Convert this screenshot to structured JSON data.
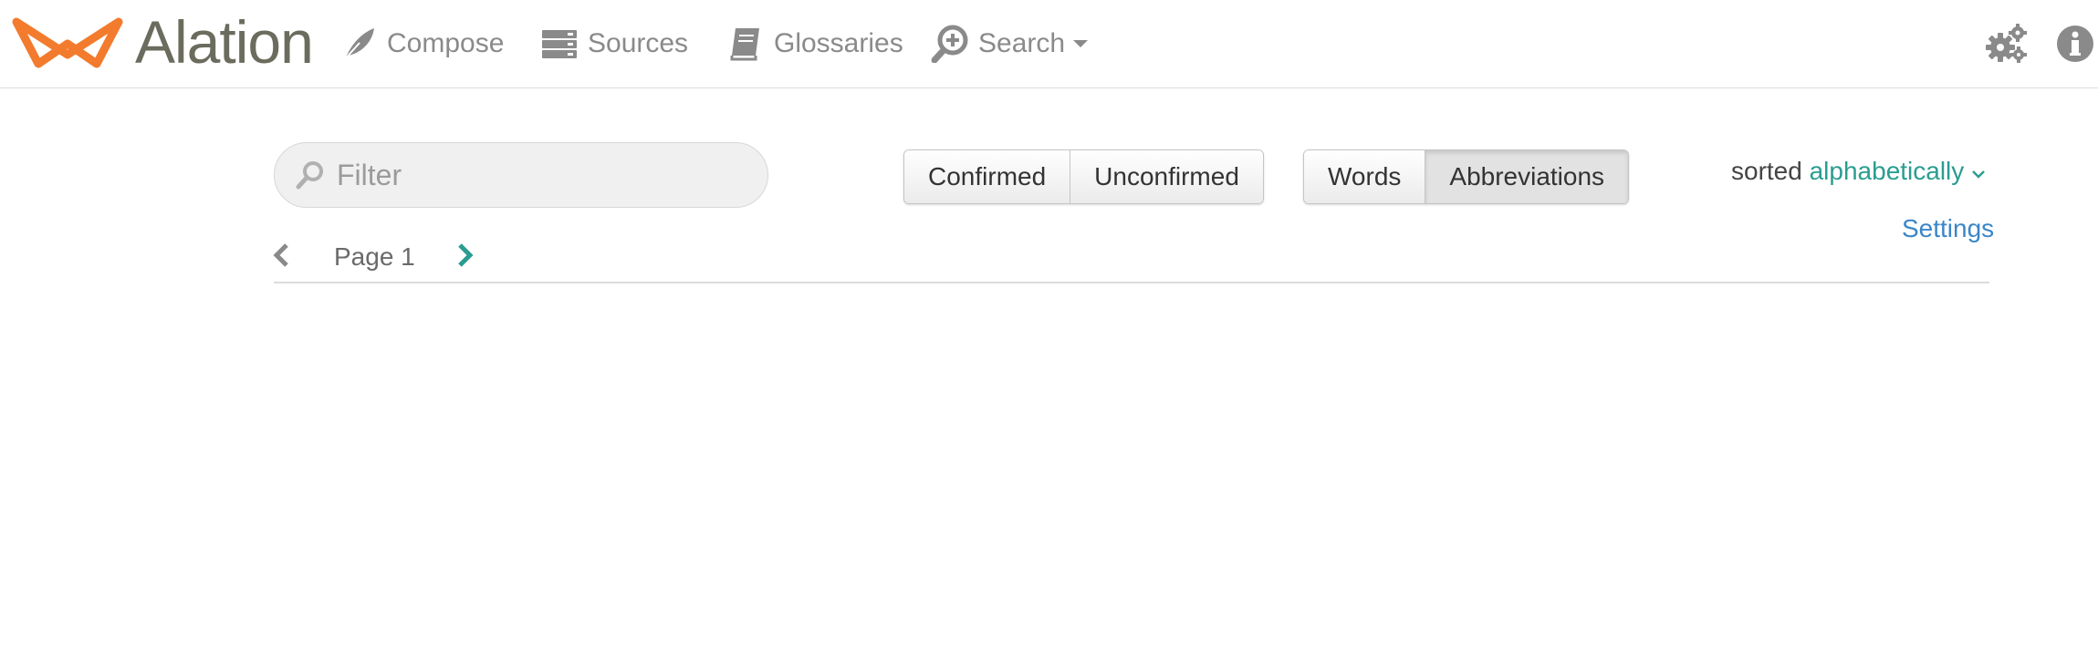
{
  "brand": {
    "name": "Alation",
    "mark_color": "#f37b2d",
    "text_color": "#6b6b5e"
  },
  "nav": {
    "items": [
      {
        "label": "Compose",
        "icon": "feather-icon"
      },
      {
        "label": "Sources",
        "icon": "server-stack-icon"
      },
      {
        "label": "Glossaries",
        "icon": "book-icon"
      },
      {
        "label": "Search",
        "icon": "search-plus-icon",
        "has_dropdown": true
      }
    ],
    "right_icons": [
      "gears-icon",
      "info-circle-icon"
    ]
  },
  "filter": {
    "placeholder": "Filter",
    "value": ""
  },
  "status_toggle": {
    "options": [
      "Confirmed",
      "Unconfirmed"
    ],
    "selected": ""
  },
  "type_toggle": {
    "options": [
      "Words",
      "Abbreviations"
    ],
    "selected": "Abbreviations"
  },
  "sort": {
    "prefix": "sorted",
    "value": "alphabetically"
  },
  "settings_label": "Settings",
  "pager": {
    "label": "Page 1",
    "page": 1
  },
  "colors": {
    "accent": "#2a9d91",
    "link": "#3a86c8"
  }
}
